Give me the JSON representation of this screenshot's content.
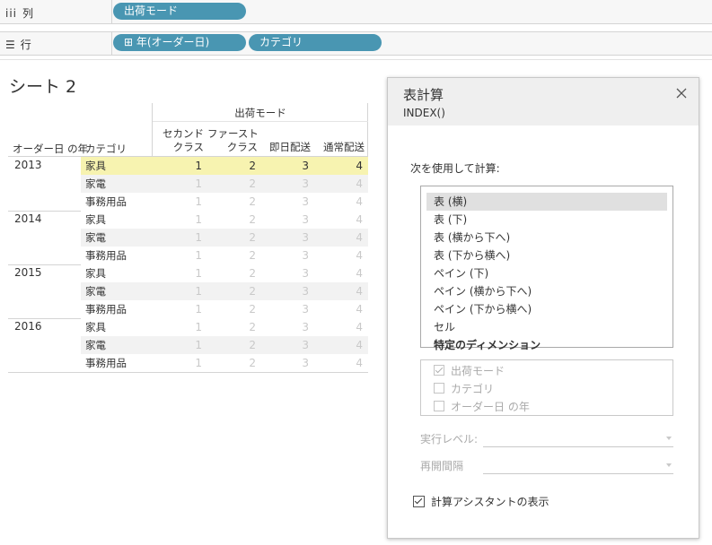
{
  "shelves": {
    "columns": {
      "label": "列",
      "pills": [
        "出荷モード"
      ]
    },
    "rows": {
      "label": "行",
      "pills": [
        "⊞ 年(オーダー日)",
        "カテゴリ"
      ]
    }
  },
  "sheet": {
    "title": "シート 2"
  },
  "table": {
    "column_header_group": "出荷モード",
    "row_headers": [
      "オーダー日 の年",
      "カテゴリ"
    ],
    "columns": [
      [
        "セカンド",
        "クラス"
      ],
      [
        "ファースト",
        "クラス"
      ],
      [
        "即日配送"
      ],
      [
        "通常配送"
      ]
    ],
    "years": [
      {
        "year": "2013",
        "categories": [
          {
            "name": "家具",
            "values": [
              "1",
              "2",
              "3",
              "4"
            ]
          },
          {
            "name": "家電",
            "values": [
              "1",
              "2",
              "3",
              "4"
            ]
          },
          {
            "name": "事務用品",
            "values": [
              "1",
              "2",
              "3",
              "4"
            ]
          }
        ]
      },
      {
        "year": "2014",
        "categories": [
          {
            "name": "家具",
            "values": [
              "1",
              "2",
              "3",
              "4"
            ]
          },
          {
            "name": "家電",
            "values": [
              "1",
              "2",
              "3",
              "4"
            ]
          },
          {
            "name": "事務用品",
            "values": [
              "1",
              "2",
              "3",
              "4"
            ]
          }
        ]
      },
      {
        "year": "2015",
        "categories": [
          {
            "name": "家具",
            "values": [
              "1",
              "2",
              "3",
              "4"
            ]
          },
          {
            "name": "家電",
            "values": [
              "1",
              "2",
              "3",
              "4"
            ]
          },
          {
            "name": "事務用品",
            "values": [
              "1",
              "2",
              "3",
              "4"
            ]
          }
        ]
      },
      {
        "year": "2016",
        "categories": [
          {
            "name": "家具",
            "values": [
              "1",
              "2",
              "3",
              "4"
            ]
          },
          {
            "name": "家電",
            "values": [
              "1",
              "2",
              "3",
              "4"
            ]
          },
          {
            "name": "事務用品",
            "values": [
              "1",
              "2",
              "3",
              "4"
            ]
          }
        ]
      }
    ],
    "highlight_color": "#f7f3b0"
  },
  "dialog": {
    "title": "表計算",
    "subtitle": "INDEX()",
    "compute_using_label": "次を使用して計算:",
    "options": [
      "表 (横)",
      "表 (下)",
      "表 (横から下へ)",
      "表 (下から横へ)",
      "ペイン (下)",
      "ペイン (横から下へ)",
      "ペイン (下から横へ)",
      "セル",
      "特定のディメンション"
    ],
    "selected_option": "表 (横)",
    "dimensions": [
      {
        "label": "出荷モード",
        "checked": true
      },
      {
        "label": "カテゴリ",
        "checked": false
      },
      {
        "label": "オーダー日 の年",
        "checked": false
      }
    ],
    "restart_level_label": "実行レベル:",
    "restart_every_label": "再開間隔",
    "show_assistant_label": "計算アシスタントの表示",
    "show_assistant_checked": true
  },
  "colors": {
    "pill": "#4996b2",
    "shelf_bg": "#f7f7f7",
    "dialog_header": "#efefef"
  }
}
